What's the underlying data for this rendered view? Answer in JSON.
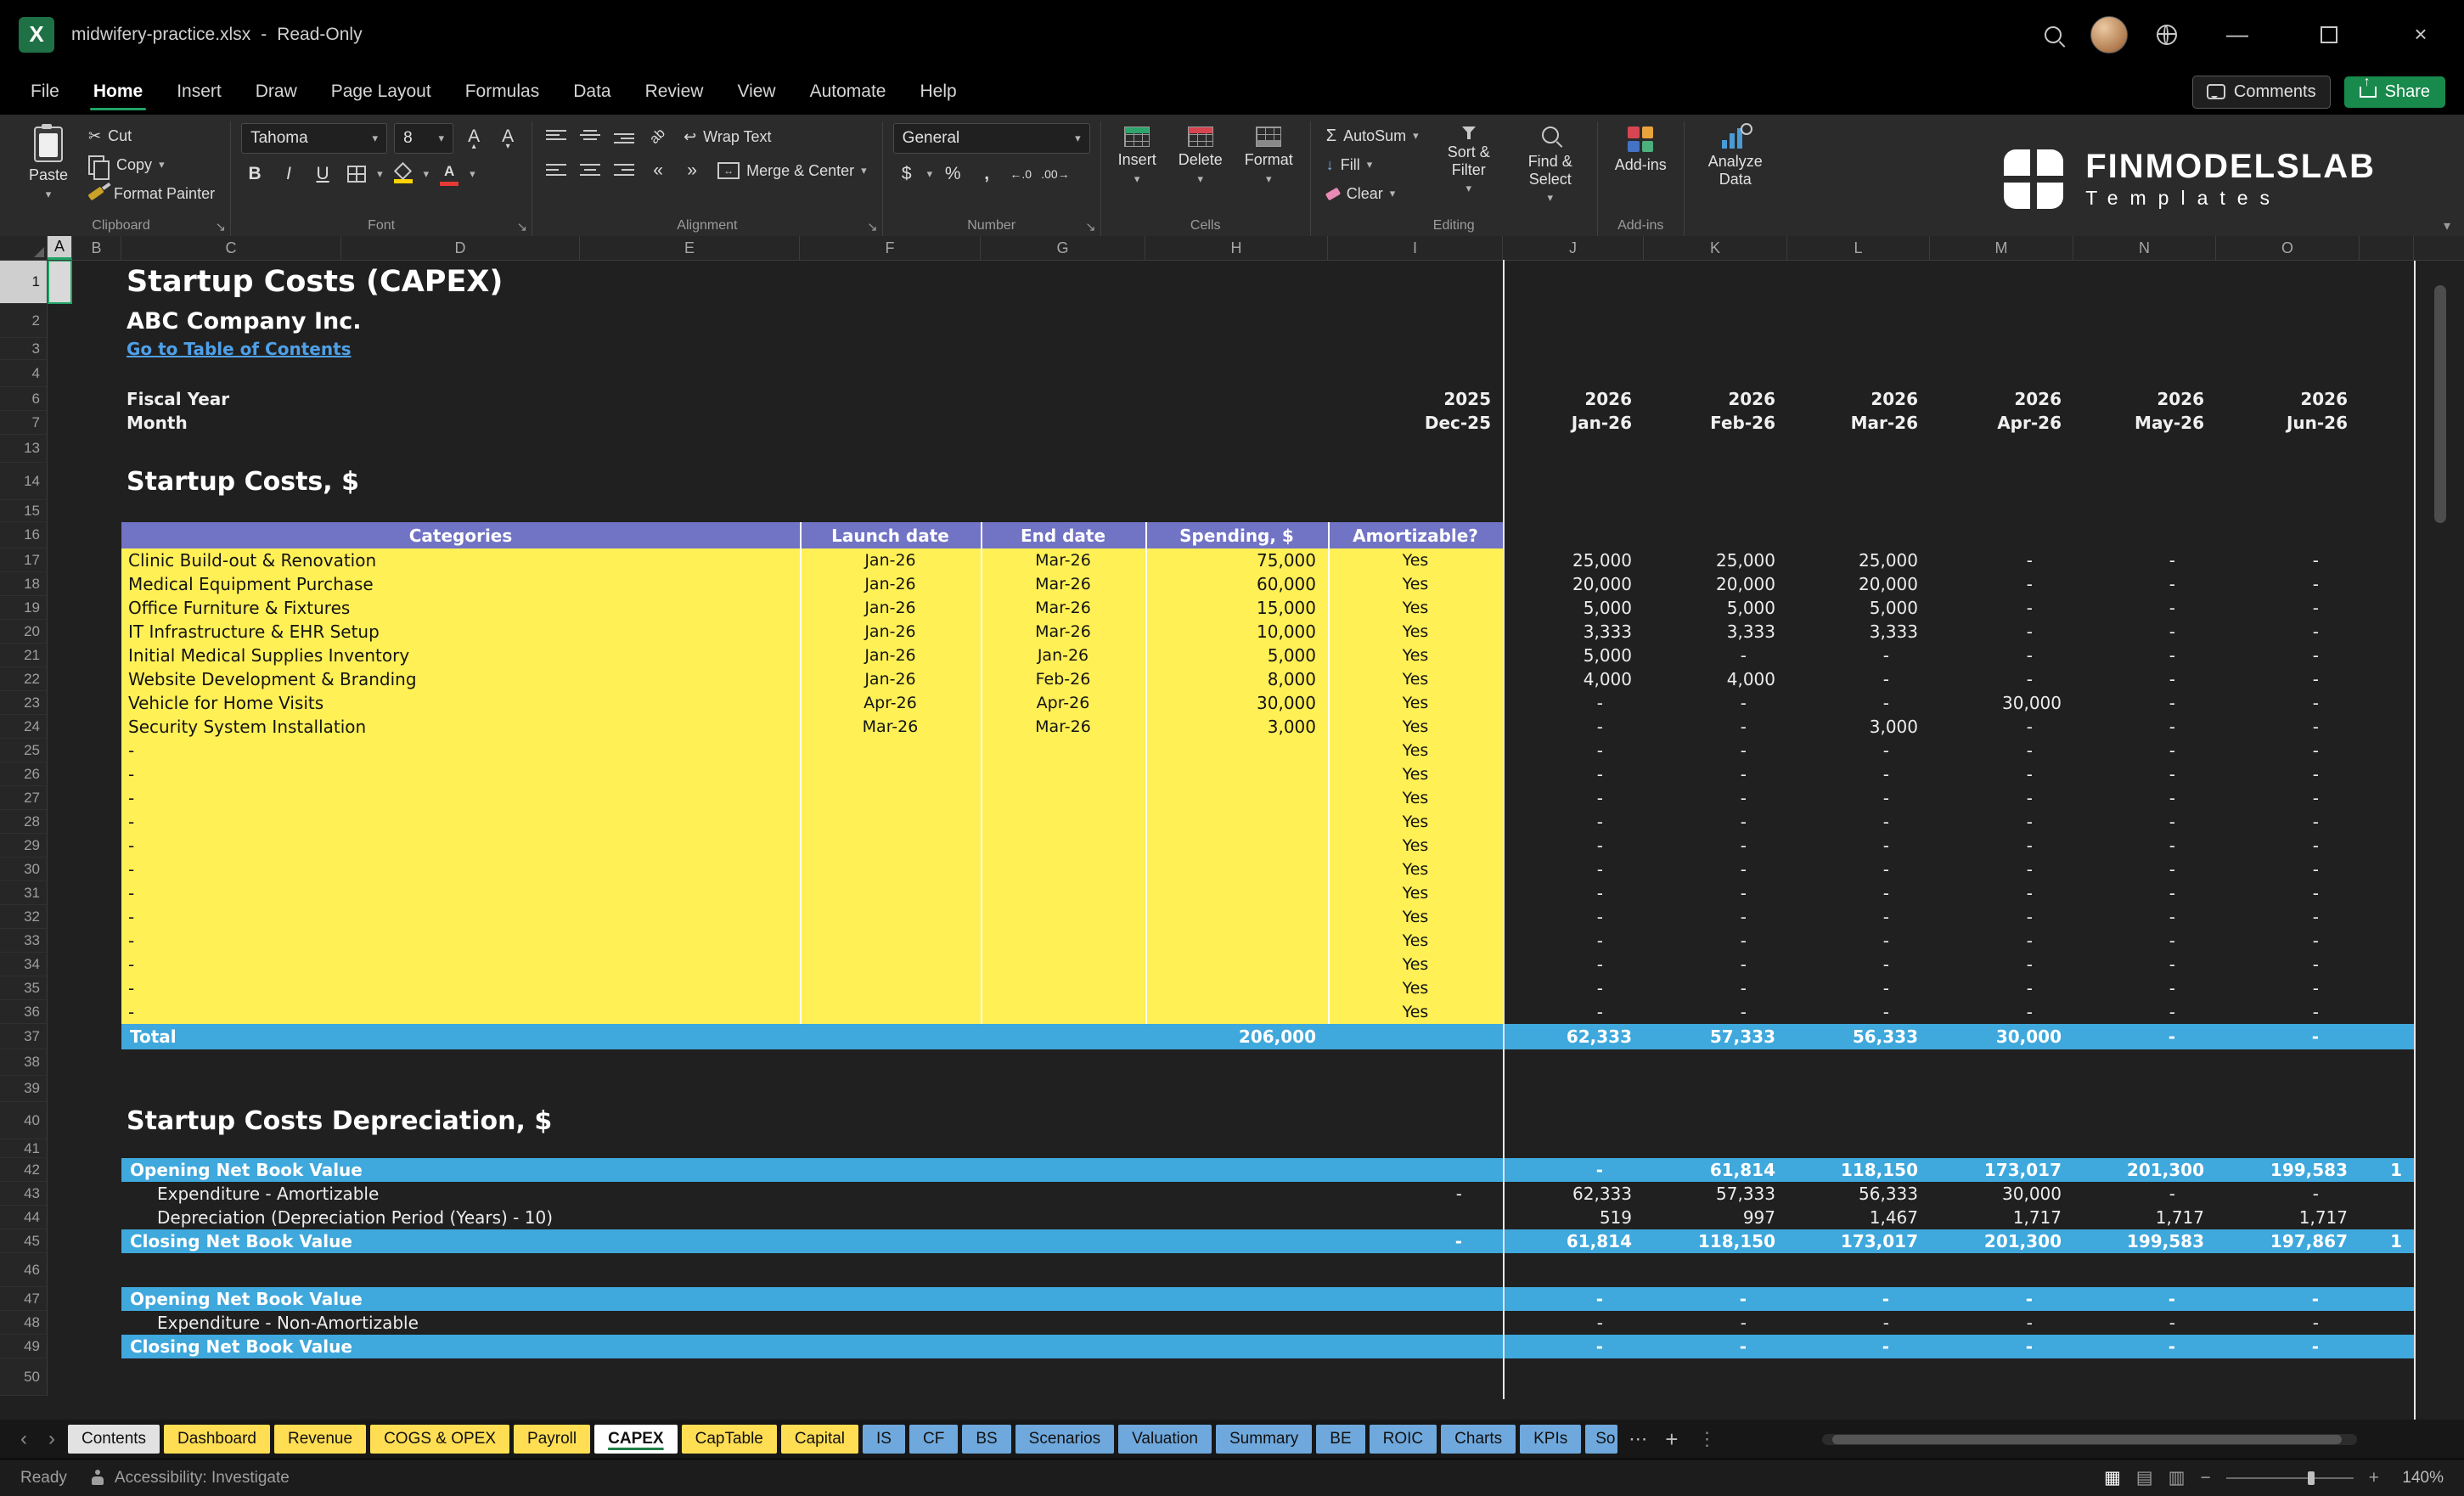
{
  "titlebar": {
    "file": "midwifery-practice.xlsx",
    "separator": "-",
    "mode": "Read-Only"
  },
  "menubar": {
    "items": [
      "File",
      "Home",
      "Insert",
      "Draw",
      "Page Layout",
      "Formulas",
      "Data",
      "Review",
      "View",
      "Automate",
      "Help"
    ],
    "active_index": 1,
    "comments": "Comments",
    "share": "Share"
  },
  "ribbon": {
    "clipboard": {
      "label": "Clipboard",
      "paste": "Paste",
      "cut": "Cut",
      "copy": "Copy",
      "format_painter": "Format Painter"
    },
    "font": {
      "label": "Font",
      "family": "Tahoma",
      "size": "8"
    },
    "alignment": {
      "label": "Alignment",
      "wrap_text": "Wrap Text",
      "merge_center": "Merge & Center"
    },
    "number": {
      "label": "Number",
      "format": "General"
    },
    "cells": {
      "label": "Cells",
      "insert": "Insert",
      "delete": "Delete",
      "format": "Format"
    },
    "editing": {
      "label": "Editing",
      "autosum": "AutoSum",
      "fill": "Fill",
      "clear": "Clear",
      "sort_filter": "Sort & Filter",
      "find_select": "Find & Select"
    },
    "addins": {
      "label": "Add-ins",
      "button": "Add-ins",
      "analyze": "Analyze Data"
    },
    "brand": {
      "name": "FINMODELSLAB",
      "sub": "Templates"
    }
  },
  "capex_table": {
    "headers": {
      "categories": "Categories",
      "launch": "Launch date",
      "end": "End date",
      "spending": "Spending, $",
      "amortizable": "Amortizable?"
    }
  },
  "grid": {
    "columns": [
      "A",
      "B",
      "C",
      "D",
      "E",
      "F",
      "G",
      "H",
      "I",
      "J",
      "K",
      "L",
      "M",
      "N",
      "O"
    ],
    "rows": [
      {
        "n": "1",
        "h": 52,
        "cells": [
          {
            "c": "C",
            "to": "I",
            "t": "Startup Costs (CAPEX)",
            "s": "title1"
          }
        ]
      },
      {
        "n": "2",
        "h": 40,
        "cells": [
          {
            "c": "C",
            "to": "I",
            "t": "ABC Company Inc.",
            "s": "title2"
          }
        ]
      },
      {
        "n": "3",
        "h": 26,
        "cells": [
          {
            "c": "C",
            "to": "I",
            "t": "Go to Table of Contents",
            "s": "link"
          }
        ]
      },
      {
        "n": "4",
        "h": 32,
        "cells": []
      },
      {
        "n": "6",
        "h": 28,
        "cells": [
          {
            "c": "C",
            "to": "E",
            "t": "Fiscal Year",
            "s": "lblb"
          },
          {
            "c": "I",
            "t": "2025",
            "s": "numb"
          },
          {
            "c": "J",
            "t": "2026",
            "s": "numb"
          },
          {
            "c": "K",
            "t": "2026",
            "s": "numb"
          },
          {
            "c": "L",
            "t": "2026",
            "s": "numb"
          },
          {
            "c": "M",
            "t": "2026",
            "s": "numb"
          },
          {
            "c": "N",
            "t": "2026",
            "s": "numb"
          },
          {
            "c": "O",
            "t": "2026",
            "s": "numb"
          }
        ]
      },
      {
        "n": "7",
        "h": 28,
        "cells": [
          {
            "c": "C",
            "to": "E",
            "t": "Month",
            "s": "lblb"
          },
          {
            "c": "I",
            "t": "Dec-25",
            "s": "numb"
          },
          {
            "c": "J",
            "t": "Jan-26",
            "s": "numb"
          },
          {
            "c": "K",
            "t": "Feb-26",
            "s": "numb"
          },
          {
            "c": "L",
            "t": "Mar-26",
            "s": "numb"
          },
          {
            "c": "M",
            "t": "Apr-26",
            "s": "numb"
          },
          {
            "c": "N",
            "t": "May-26",
            "s": "numb"
          },
          {
            "c": "O",
            "t": "Jun-26",
            "s": "numb"
          }
        ]
      },
      {
        "n": "13",
        "h": 33,
        "cells": []
      },
      {
        "n": "14",
        "h": 44,
        "cells": [
          {
            "c": "C",
            "to": "I",
            "t": "Startup Costs, $",
            "s": "sec"
          }
        ]
      },
      {
        "n": "15",
        "h": 26,
        "cells": []
      },
      {
        "n": "16",
        "h": 31,
        "type": "thead"
      },
      {
        "n": "17",
        "h": 28,
        "type": "capex",
        "cat": "Clinic Build-out & Renovation",
        "launch": "Jan-26",
        "end": "Mar-26",
        "spend": "75,000",
        "amort": "Yes",
        "m": [
          "25,000",
          "25,000",
          "25,000",
          "-",
          "-",
          "-"
        ]
      },
      {
        "n": "18",
        "h": 28,
        "type": "capex",
        "cat": "Medical Equipment Purchase",
        "launch": "Jan-26",
        "end": "Mar-26",
        "spend": "60,000",
        "amort": "Yes",
        "m": [
          "20,000",
          "20,000",
          "20,000",
          "-",
          "-",
          "-"
        ]
      },
      {
        "n": "19",
        "h": 28,
        "type": "capex",
        "cat": "Office Furniture & Fixtures",
        "launch": "Jan-26",
        "end": "Mar-26",
        "spend": "15,000",
        "amort": "Yes",
        "m": [
          "5,000",
          "5,000",
          "5,000",
          "-",
          "-",
          "-"
        ]
      },
      {
        "n": "20",
        "h": 28,
        "type": "capex",
        "cat": "IT Infrastructure & EHR Setup",
        "launch": "Jan-26",
        "end": "Mar-26",
        "spend": "10,000",
        "amort": "Yes",
        "m": [
          "3,333",
          "3,333",
          "3,333",
          "-",
          "-",
          "-"
        ]
      },
      {
        "n": "21",
        "h": 28,
        "type": "capex",
        "cat": "Initial Medical Supplies Inventory",
        "launch": "Jan-26",
        "end": "Jan-26",
        "spend": "5,000",
        "amort": "Yes",
        "m": [
          "5,000",
          "-",
          "-",
          "-",
          "-",
          "-"
        ]
      },
      {
        "n": "22",
        "h": 28,
        "type": "capex",
        "cat": "Website Development & Branding",
        "launch": "Jan-26",
        "end": "Feb-26",
        "spend": "8,000",
        "amort": "Yes",
        "m": [
          "4,000",
          "4,000",
          "-",
          "-",
          "-",
          "-"
        ]
      },
      {
        "n": "23",
        "h": 28,
        "type": "capex",
        "cat": "Vehicle for Home Visits",
        "launch": "Apr-26",
        "end": "Apr-26",
        "spend": "30,000",
        "amort": "Yes",
        "m": [
          "-",
          "-",
          "-",
          "30,000",
          "-",
          "-"
        ]
      },
      {
        "n": "24",
        "h": 28,
        "type": "capex",
        "cat": "Security System Installation",
        "launch": "Mar-26",
        "end": "Mar-26",
        "spend": "3,000",
        "amort": "Yes",
        "m": [
          "-",
          "-",
          "3,000",
          "-",
          "-",
          "-"
        ]
      },
      {
        "n": "25",
        "h": 28,
        "type": "capex",
        "cat": "-",
        "launch": "",
        "end": "",
        "spend": "",
        "amort": "Yes",
        "m": [
          "-",
          "-",
          "-",
          "-",
          "-",
          "-"
        ]
      },
      {
        "n": "26",
        "h": 28,
        "type": "capex",
        "cat": "-",
        "launch": "",
        "end": "",
        "spend": "",
        "amort": "Yes",
        "m": [
          "-",
          "-",
          "-",
          "-",
          "-",
          "-"
        ]
      },
      {
        "n": "27",
        "h": 28,
        "type": "capex",
        "cat": "-",
        "launch": "",
        "end": "",
        "spend": "",
        "amort": "Yes",
        "m": [
          "-",
          "-",
          "-",
          "-",
          "-",
          "-"
        ]
      },
      {
        "n": "28",
        "h": 28,
        "type": "capex",
        "cat": "-",
        "launch": "",
        "end": "",
        "spend": "",
        "amort": "Yes",
        "m": [
          "-",
          "-",
          "-",
          "-",
          "-",
          "-"
        ]
      },
      {
        "n": "29",
        "h": 28,
        "type": "capex",
        "cat": "-",
        "launch": "",
        "end": "",
        "spend": "",
        "amort": "Yes",
        "m": [
          "-",
          "-",
          "-",
          "-",
          "-",
          "-"
        ]
      },
      {
        "n": "30",
        "h": 28,
        "type": "capex",
        "cat": "-",
        "launch": "",
        "end": "",
        "spend": "",
        "amort": "Yes",
        "m": [
          "-",
          "-",
          "-",
          "-",
          "-",
          "-"
        ]
      },
      {
        "n": "31",
        "h": 28,
        "type": "capex",
        "cat": "-",
        "launch": "",
        "end": "",
        "spend": "",
        "amort": "Yes",
        "m": [
          "-",
          "-",
          "-",
          "-",
          "-",
          "-"
        ]
      },
      {
        "n": "32",
        "h": 28,
        "type": "capex",
        "cat": "-",
        "launch": "",
        "end": "",
        "spend": "",
        "amort": "Yes",
        "m": [
          "-",
          "-",
          "-",
          "-",
          "-",
          "-"
        ]
      },
      {
        "n": "33",
        "h": 28,
        "type": "capex",
        "cat": "-",
        "launch": "",
        "end": "",
        "spend": "",
        "amort": "Yes",
        "m": [
          "-",
          "-",
          "-",
          "-",
          "-",
          "-"
        ]
      },
      {
        "n": "34",
        "h": 28,
        "type": "capex",
        "cat": "-",
        "launch": "",
        "end": "",
        "spend": "",
        "amort": "Yes",
        "m": [
          "-",
          "-",
          "-",
          "-",
          "-",
          "-"
        ]
      },
      {
        "n": "35",
        "h": 28,
        "type": "capex",
        "cat": "-",
        "launch": "",
        "end": "",
        "spend": "",
        "amort": "Yes",
        "m": [
          "-",
          "-",
          "-",
          "-",
          "-",
          "-"
        ]
      },
      {
        "n": "36",
        "h": 28,
        "type": "capex",
        "cat": "-",
        "launch": "",
        "end": "",
        "spend": "",
        "amort": "Yes",
        "m": [
          "-",
          "-",
          "-",
          "-",
          "-",
          "-"
        ]
      },
      {
        "n": "37",
        "h": 30,
        "type": "total",
        "label": "Total",
        "spend": "206,000",
        "m": [
          "62,333",
          "57,333",
          "56,333",
          "30,000",
          "-",
          "-"
        ]
      },
      {
        "n": "38",
        "h": 31,
        "cells": []
      },
      {
        "n": "39",
        "h": 31,
        "cells": []
      },
      {
        "n": "40",
        "h": 44,
        "cells": [
          {
            "c": "C",
            "to": "I",
            "t": "Startup Costs Depreciation, $",
            "s": "sec"
          }
        ]
      },
      {
        "n": "41",
        "h": 22,
        "cells": []
      },
      {
        "n": "42",
        "h": 28,
        "type": "blue",
        "label": "Opening Net Book Value",
        "m": [
          "-",
          "61,814",
          "118,150",
          "173,017",
          "201,300",
          "199,583"
        ],
        "p": "1"
      },
      {
        "n": "43",
        "h": 28,
        "type": "plain",
        "label": "Expenditure - Amortizable",
        "i": "-",
        "m": [
          "62,333",
          "57,333",
          "56,333",
          "30,000",
          "-",
          "-"
        ]
      },
      {
        "n": "44",
        "h": 28,
        "type": "plain",
        "label": "Depreciation (Depreciation Period (Years) - 10)",
        "m": [
          "519",
          "997",
          "1,467",
          "1,717",
          "1,717",
          "1,717"
        ]
      },
      {
        "n": "45",
        "h": 28,
        "type": "blue",
        "label": "Closing Net Book Value",
        "i": "-",
        "m": [
          "61,814",
          "118,150",
          "173,017",
          "201,300",
          "199,583",
          "197,867"
        ],
        "p": "1"
      },
      {
        "n": "46",
        "h": 40,
        "cells": []
      },
      {
        "n": "47",
        "h": 28,
        "type": "blue",
        "label": "Opening Net Book Value",
        "m": [
          "-",
          "-",
          "-",
          "-",
          "-",
          "-"
        ]
      },
      {
        "n": "48",
        "h": 28,
        "type": "plain",
        "label": "Expenditure - Non-Amortizable",
        "m": [
          "-",
          "-",
          "-",
          "-",
          "-",
          "-"
        ]
      },
      {
        "n": "49",
        "h": 28,
        "type": "blue",
        "label": "Closing Net Book Value",
        "m": [
          "-",
          "-",
          "-",
          "-",
          "-",
          "-"
        ]
      },
      {
        "n": "50",
        "h": 44,
        "cells": []
      }
    ]
  },
  "tabs": {
    "items": [
      {
        "label": "Contents",
        "color": "gray"
      },
      {
        "label": "Dashboard",
        "color": "yellow"
      },
      {
        "label": "Revenue",
        "color": "yellow"
      },
      {
        "label": "COGS & OPEX",
        "color": "yellow"
      },
      {
        "label": "Payroll",
        "color": "yellow"
      },
      {
        "label": "CAPEX",
        "color": "active"
      },
      {
        "label": "CapTable",
        "color": "yellow"
      },
      {
        "label": "Capital",
        "color": "yellow"
      },
      {
        "label": "IS",
        "color": "blue"
      },
      {
        "label": "CF",
        "color": "blue"
      },
      {
        "label": "BS",
        "color": "blue"
      },
      {
        "label": "Scenarios",
        "color": "blue"
      },
      {
        "label": "Valuation",
        "color": "blue"
      },
      {
        "label": "Summary",
        "color": "blue"
      },
      {
        "label": "BE",
        "color": "blue"
      },
      {
        "label": "ROIC",
        "color": "blue"
      },
      {
        "label": "Charts",
        "color": "blue"
      },
      {
        "label": "KPIs",
        "color": "blue"
      },
      {
        "label": "So",
        "color": "blue",
        "clipped": true
      }
    ]
  },
  "statusbar": {
    "ready": "Ready",
    "accessibility": "Accessibility: Investigate",
    "zoom": "140%"
  },
  "colors": {
    "accent_green": "#21A366",
    "band_yellow": "#FFF056",
    "band_purple": "#7173C4",
    "band_blue": "#3FA8DC",
    "tab_yellow": "#FFDE54",
    "tab_blue": "#6FA8DC",
    "link_blue": "#4FA0E8"
  }
}
